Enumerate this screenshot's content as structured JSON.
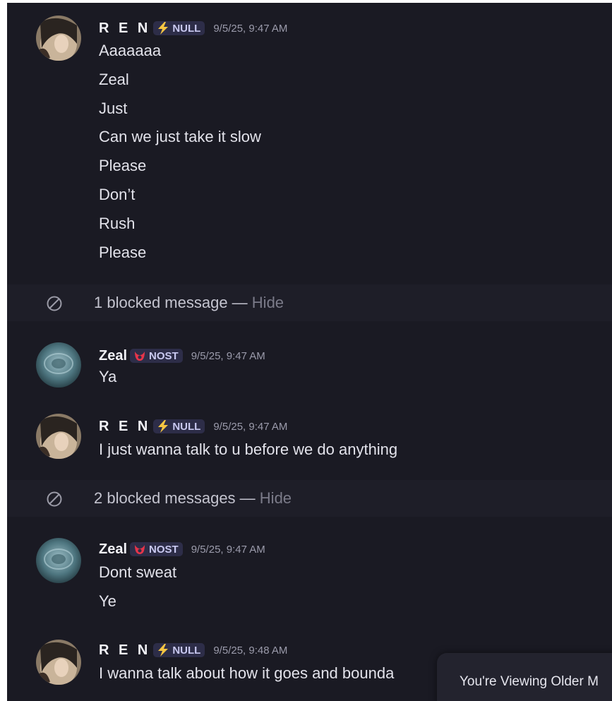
{
  "chat": {
    "users": {
      "ren": {
        "name": "R E N",
        "tag": "NULL",
        "tag_icon": "lightning-icon",
        "accent": "#f5c542"
      },
      "zeal": {
        "name": "Zeal",
        "tag": "NOST",
        "tag_icon": "red-crest-icon",
        "accent": "#e6354a"
      }
    },
    "groups": [
      {
        "author": "R E N",
        "tag": "NULL",
        "timestamp": "9/5/25, 9:47 AM",
        "messages": [
          "Aaaaaaa",
          "Zeal",
          "Just",
          "Can we just take it slow",
          "Please",
          "Don’t",
          "Rush",
          "Please"
        ]
      },
      {
        "author": "Zeal",
        "tag": "NOST",
        "timestamp": "9/5/25, 9:47 AM",
        "messages": [
          "Ya"
        ]
      },
      {
        "author": "R E N",
        "tag": "NULL",
        "timestamp": "9/5/25, 9:47 AM",
        "messages": [
          "I just wanna talk to u before we do anything"
        ]
      },
      {
        "author": "Zeal",
        "tag": "NOST",
        "timestamp": "9/5/25, 9:47 AM",
        "messages": [
          "Dont sweat",
          "Ye"
        ]
      },
      {
        "author": "R E N",
        "tag": "NULL",
        "timestamp": "9/5/25, 9:48 AM",
        "messages": [
          "I wanna talk about how it goes and bounda"
        ]
      }
    ],
    "blocked": [
      {
        "text": "1 blocked message —",
        "action": "Hide",
        "icon": "blocked-icon"
      },
      {
        "text": "2 blocked messages —",
        "action": "Hide",
        "icon": "blocked-icon"
      }
    ],
    "older_banner": "You're Viewing Older M"
  }
}
